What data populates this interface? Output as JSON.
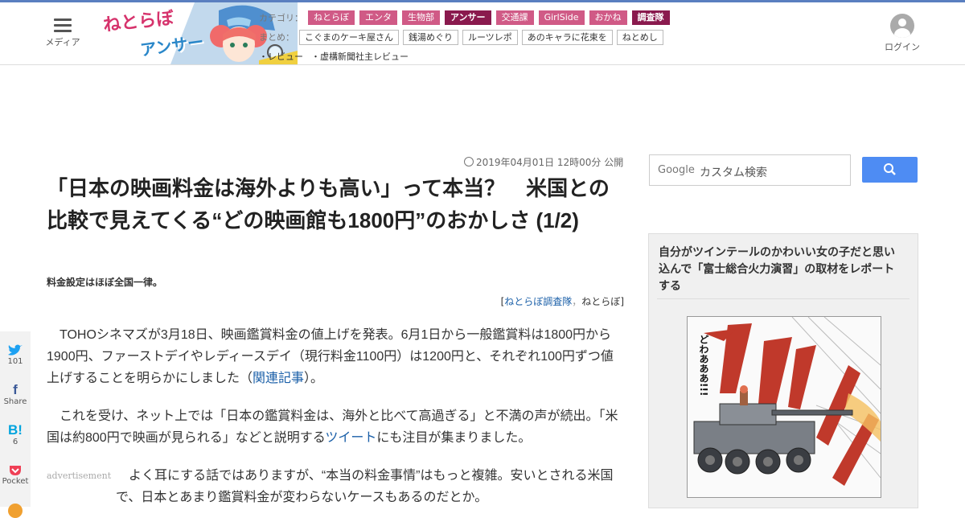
{
  "header": {
    "menu_label": "メディア",
    "logo_text_1": "ねとらぼ",
    "logo_text_2": "アンサー",
    "category_label": "カテゴリ：",
    "categories": [
      "ねとらぼ",
      "エンタ",
      "生物部",
      "アンサー",
      "交通課",
      "GirlSide",
      "おかね",
      "調査隊"
    ],
    "matome_label": "まとめ：",
    "matome": [
      "こぐまのケーキ屋さん",
      "銭湯めぐり",
      "ルーツレポ",
      "あのキャラに花束を",
      "ねとめし"
    ],
    "reviews": [
      "・レビュー",
      "・虚構新聞社主レビュー"
    ],
    "login_label": "ログイン"
  },
  "article": {
    "date": "2019年04月01日 12時00分 公開",
    "title": "「日本の映画料金は海外よりも高い」って本当？　米国との比較で見えてくる“どの映画館も1800円”のおかしさ (1/2)",
    "subtitle": "料金設定はほぼ全国一律。",
    "credit_open": "[",
    "credit_author": "ねとらぼ調査隊",
    "credit_sep": "，",
    "credit_site": "ねとらぼ",
    "credit_close": "]",
    "p1_text": "　TOHOシネマズが3月18日、映画鑑賞料金の値上げを発表。6月1日から一般鑑賞料は1800円から1900円、ファーストデイやレディースデイ（現行料金1100円）は1200円と、それぞれ100円ずつ値上げすることを明らかにしました（",
    "p1_link": "関連記事",
    "p1_end": "）。",
    "p2_text": "　これを受け、ネット上では「日本の鑑賞料金は、海外と比べて高過ぎる」と不満の声が続出。「米国は約800円で映画が見られる」などと説明する",
    "p2_link": "ツイート",
    "p2_end": "にも注目が集まりました。",
    "advertisement": "advertisement",
    "p3_text": "　よく耳にする話ではありますが、“本当の料金事情”はもっと複雑。安いとされる米国で、日本とあまり鑑賞料金が変わらないケースもあるのだとか。"
  },
  "share": {
    "twitter_count": "101",
    "facebook_label": "Share",
    "hatena_count": "6",
    "pocket_label": "Pocket"
  },
  "search": {
    "brand": "Google",
    "placeholder": "カスタム検索"
  },
  "sidebar": {
    "feature_title": "自分がツインテールのかわいい女の子だと思い込んで「富士総合火力演習」の取材をレポートする",
    "manga_sfx": "どわあああ!!!"
  },
  "colors": {
    "accent": "#d05a86",
    "link": "#1a5fa8",
    "search_button": "#4e8cf3"
  }
}
